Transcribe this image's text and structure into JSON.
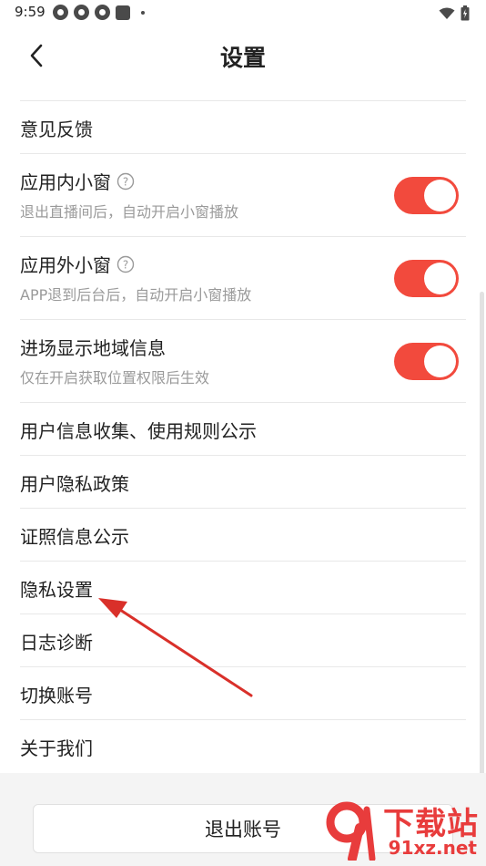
{
  "status_bar": {
    "time": "9:59",
    "icons_left": [
      "app-notification-icon",
      "app-notification-icon",
      "app-notification-icon",
      "app-square-icon",
      "dot-icon"
    ],
    "icons_right": [
      "wifi-icon",
      "battery-icon"
    ]
  },
  "nav": {
    "title": "设置",
    "back_icon": "chevron-left-icon"
  },
  "settings": {
    "feedback": "意见反馈",
    "in_app_window": {
      "label": "应用内小窗",
      "desc": "退出直播间后，自动开启小窗播放",
      "enabled": true
    },
    "out_app_window": {
      "label": "应用外小窗",
      "desc": "APP退到后台后，自动开启小窗播放",
      "enabled": true
    },
    "show_region": {
      "label": "进场显示地域信息",
      "desc": "仅在开启获取位置权限后生效",
      "enabled": true
    },
    "info_collection": "用户信息收集、使用规则公示",
    "privacy_policy": "用户隐私政策",
    "license_info": "证照信息公示",
    "privacy_settings": "隐私设置",
    "log_diagnosis": "日志诊断",
    "switch_account": "切换账号",
    "about_us": "关于我们"
  },
  "logout_label": "退出账号",
  "colors": {
    "toggle_on": "#f24a3d",
    "accent_arrow": "#d9302a",
    "watermark": "#e83c3c"
  },
  "watermark": {
    "title": "下载站",
    "url": "91xz.net"
  }
}
